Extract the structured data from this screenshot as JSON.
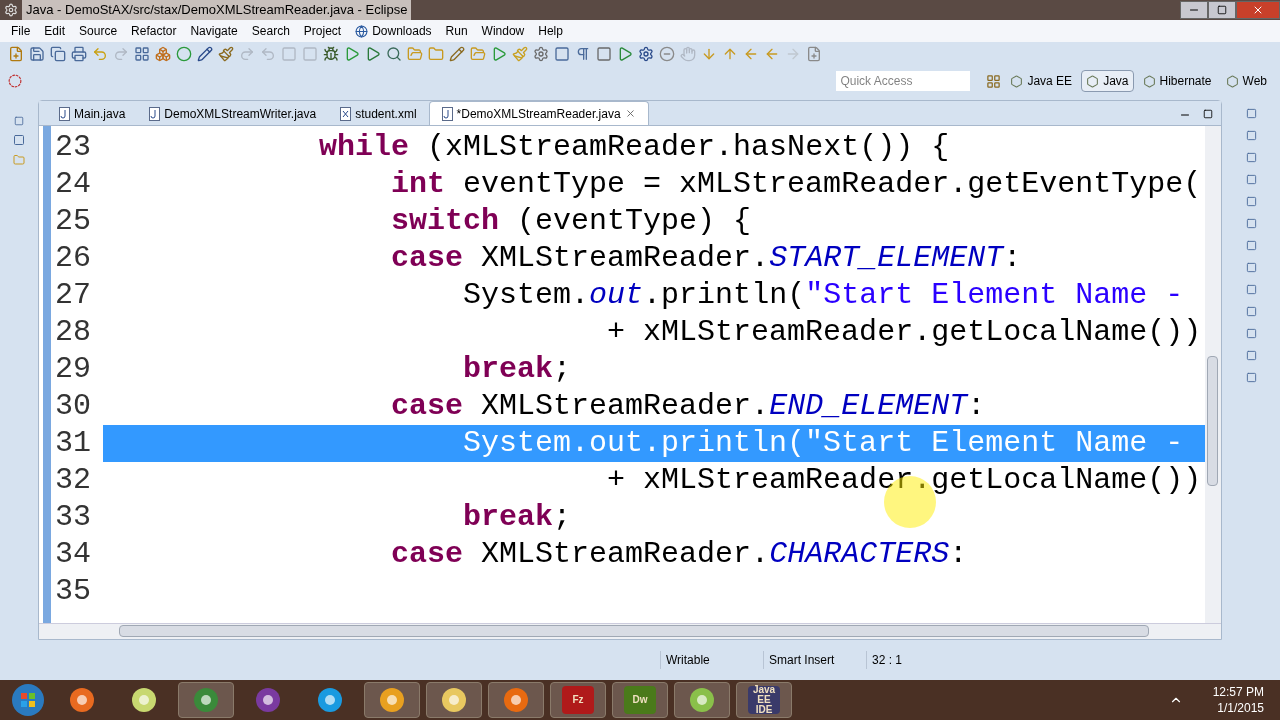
{
  "window": {
    "title": "Java - DemoStAX/src/stax/DemoXMLStreamReader.java - Eclipse"
  },
  "menu": [
    "File",
    "Edit",
    "Source",
    "Refactor",
    "Navigate",
    "Search",
    "Project",
    "Downloads",
    "Run",
    "Window",
    "Help"
  ],
  "quick_access": {
    "placeholder": "Quick Access"
  },
  "perspectives": [
    {
      "label": "Java EE",
      "selected": false
    },
    {
      "label": "Java",
      "selected": true
    },
    {
      "label": "Hibernate",
      "selected": false
    },
    {
      "label": "Web",
      "selected": false
    }
  ],
  "tabs": [
    {
      "label": "Main.java",
      "kind": "java",
      "selected": false
    },
    {
      "label": "DemoXMLStreamWriter.java",
      "kind": "java",
      "selected": false
    },
    {
      "label": "student.xml",
      "kind": "xml",
      "selected": false
    },
    {
      "label": "*DemoXMLStreamReader.java",
      "kind": "java",
      "selected": true
    }
  ],
  "code_lines": [
    {
      "number": "23",
      "selected": false,
      "tokens": [
        {
          "kind": "keyword",
          "text": "            while"
        },
        {
          "kind": "plain",
          "text": " (xMLStreamReader.hasNext()) {"
        }
      ]
    },
    {
      "number": "24",
      "selected": false,
      "tokens": [
        {
          "kind": "keyword",
          "text": "                int"
        },
        {
          "kind": "plain",
          "text": " eventType = xMLStreamReader.getEventType("
        }
      ]
    },
    {
      "number": "25",
      "selected": false,
      "tokens": [
        {
          "kind": "keyword",
          "text": "                switch"
        },
        {
          "kind": "plain",
          "text": " (eventType) {"
        }
      ]
    },
    {
      "number": "26",
      "selected": false,
      "tokens": [
        {
          "kind": "keyword",
          "text": "                case"
        },
        {
          "kind": "plain",
          "text": " XMLStreamReader."
        },
        {
          "kind": "field",
          "text": "START_ELEMENT"
        },
        {
          "kind": "plain",
          "text": ":"
        }
      ]
    },
    {
      "number": "27",
      "selected": false,
      "tokens": [
        {
          "kind": "plain",
          "text": "                    System."
        },
        {
          "kind": "field",
          "text": "out"
        },
        {
          "kind": "plain",
          "text": ".println("
        },
        {
          "kind": "string",
          "text": "\"Start Element Name -"
        }
      ]
    },
    {
      "number": "28",
      "selected": false,
      "tokens": [
        {
          "kind": "plain",
          "text": "                            + xMLStreamReader.getLocalName())"
        }
      ]
    },
    {
      "number": "29",
      "selected": false,
      "tokens": [
        {
          "kind": "keyword",
          "text": "                    break"
        },
        {
          "kind": "plain",
          "text": ";"
        }
      ]
    },
    {
      "number": "30",
      "selected": false,
      "tokens": [
        {
          "kind": "keyword",
          "text": "                case"
        },
        {
          "kind": "plain",
          "text": " XMLStreamReader."
        },
        {
          "kind": "field",
          "text": "END_ELEMENT"
        },
        {
          "kind": "plain",
          "text": ":"
        }
      ]
    },
    {
      "number": "31",
      "selected": true,
      "tokens": [
        {
          "kind": "plain",
          "text": "                    System.out.println(\"Start Element Name -"
        }
      ]
    },
    {
      "number": "32",
      "selected": false,
      "tokens": [
        {
          "kind": "plain",
          "text": "                            + xMLStreamReader.getLocalName())"
        }
      ]
    },
    {
      "number": "33",
      "selected": false,
      "tokens": [
        {
          "kind": "keyword",
          "text": "                    break"
        },
        {
          "kind": "plain",
          "text": ";"
        }
      ]
    },
    {
      "number": "34",
      "selected": false,
      "tokens": [
        {
          "kind": "keyword",
          "text": "                case"
        },
        {
          "kind": "plain",
          "text": " XMLStreamReader."
        },
        {
          "kind": "field",
          "text": "CHARACTERS"
        },
        {
          "kind": "plain",
          "text": ":"
        }
      ]
    },
    {
      "number": "35",
      "selected": false
    }
  ],
  "status_bar": [
    "Writable",
    "Smart Insert",
    "32 : 1"
  ],
  "taskbar": {
    "apps": [
      {
        "kind": "media",
        "running": false
      },
      {
        "kind": "notes",
        "running": false
      },
      {
        "kind": "chrome",
        "running": true
      },
      {
        "kind": "messenger",
        "running": false
      },
      {
        "kind": "skype",
        "running": false
      },
      {
        "kind": "outlook",
        "running": true
      },
      {
        "kind": "folder",
        "running": true
      },
      {
        "kind": "firefox",
        "running": true
      },
      {
        "kind": "filezilla",
        "running": true,
        "label": "Fz"
      },
      {
        "kind": "dreamweaver",
        "running": true,
        "label": "Dw"
      },
      {
        "kind": "notepad",
        "running": true
      },
      {
        "kind": "eclipse",
        "running": true,
        "label": "Java EE IDE"
      }
    ],
    "time": "12:57 PM",
    "date": "1/1/2015"
  }
}
